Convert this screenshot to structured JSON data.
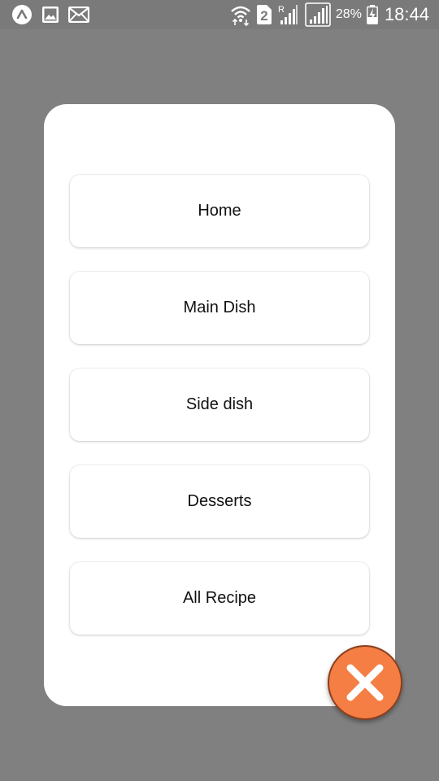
{
  "status_bar": {
    "icons_left": [
      "app-icon",
      "gallery-icon",
      "mail-icon"
    ],
    "icons_right": [
      "wifi-icon",
      "sim2-icon",
      "signal-roaming-icon",
      "signal-icon",
      "battery-charging-icon"
    ],
    "sim_number": "2",
    "roaming_label": "R",
    "battery_percent": "28%",
    "time": "18:44"
  },
  "menu": {
    "items": [
      {
        "label": "Home"
      },
      {
        "label": "Main Dish"
      },
      {
        "label": "Side dish"
      },
      {
        "label": "Desserts"
      },
      {
        "label": "All Recipe"
      }
    ]
  },
  "close_button": {
    "icon": "close-icon"
  },
  "colors": {
    "overlay": "#808080",
    "card": "#ffffff",
    "accent": "#f47e44",
    "accent_border": "#8a3f1c"
  }
}
